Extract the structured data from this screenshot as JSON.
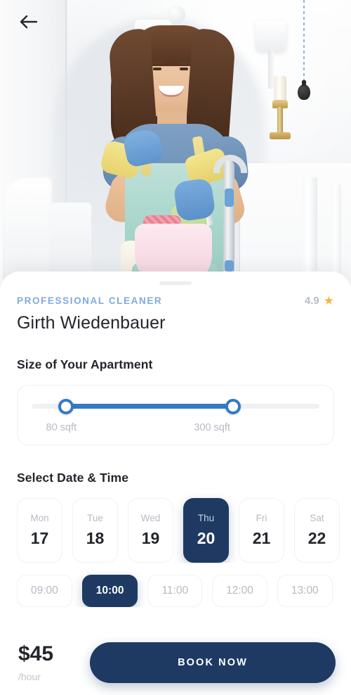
{
  "nav": {
    "back_icon": "arrow-left-icon"
  },
  "hero": {
    "alt": "professional cleaner standing in bright living room with vacuum"
  },
  "profile": {
    "eyebrow": "PROFESSIONAL CLEANER",
    "name": "Girth Wiedenbauer",
    "rating": "4.9",
    "star_icon": "star-icon"
  },
  "size_section": {
    "title": "Size of Your Apartment",
    "min_label": "80 sqft",
    "max_label": "300 sqft",
    "min_percent": 12,
    "max_percent": 70
  },
  "datetime_section": {
    "title": "Select Date & Time",
    "dates": [
      {
        "dow": "Mon",
        "day": "17",
        "selected": false
      },
      {
        "dow": "Tue",
        "day": "18",
        "selected": false
      },
      {
        "dow": "Wed",
        "day": "19",
        "selected": false
      },
      {
        "dow": "Thu",
        "day": "20",
        "selected": true
      },
      {
        "dow": "Fri",
        "day": "21",
        "selected": false
      },
      {
        "dow": "Sat",
        "day": "22",
        "selected": false
      }
    ],
    "times": [
      {
        "label": "09:00",
        "selected": false
      },
      {
        "label": "10:00",
        "selected": true
      },
      {
        "label": "11:00",
        "selected": false
      },
      {
        "label": "12:00",
        "selected": false
      },
      {
        "label": "13:00",
        "selected": false
      }
    ]
  },
  "footer": {
    "price": "$45",
    "unit": "/hour",
    "book_label": "BOOK NOW"
  },
  "colors": {
    "navy": "#1e3a63",
    "blue_accent": "#3479c4",
    "eyebrow_blue": "#7fabda",
    "star_gold": "#efb93b",
    "muted": "#b6bbc2"
  }
}
